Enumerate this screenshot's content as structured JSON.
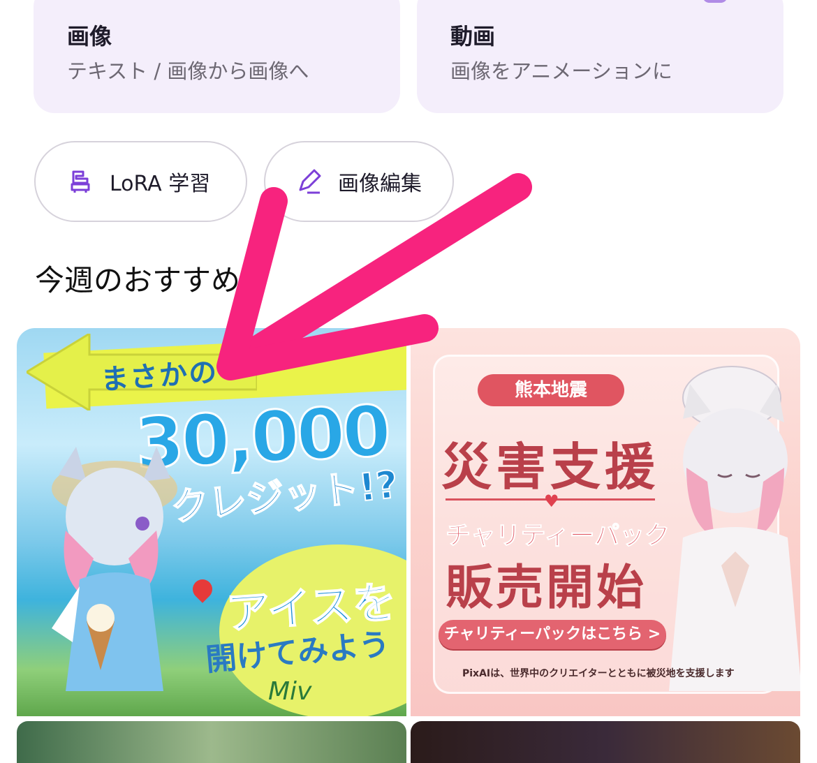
{
  "feature_cards": [
    {
      "title": "画像",
      "subtitle": "テキスト / 画像から画像へ"
    },
    {
      "title": "動画",
      "subtitle": "画像をアニメーションに"
    }
  ],
  "pills": [
    {
      "label": "LoRA 学習",
      "icon": "lora-icon"
    },
    {
      "label": "画像編集",
      "icon": "pencil-icon"
    }
  ],
  "section": {
    "title": "今週のおすすめ"
  },
  "banners": {
    "left": {
      "line1": "まさかの",
      "number": "30,000",
      "credit": "クレジット!?",
      "ice": "アイスを",
      "open": "開けてみよう",
      "sign": "Miv"
    },
    "right": {
      "tag": "熊本地震",
      "main": "災害支援",
      "charity": "チャリティーパック",
      "sale": "販売開始",
      "button": "チャリティーパックはこちら >",
      "note": "PixAIは、世界中のクリエイターとともに被災地を支援します"
    }
  },
  "colors": {
    "card_bg": "#f4eefb",
    "accent": "#7c3fd8",
    "overlay_arrow": "#f7237e"
  }
}
